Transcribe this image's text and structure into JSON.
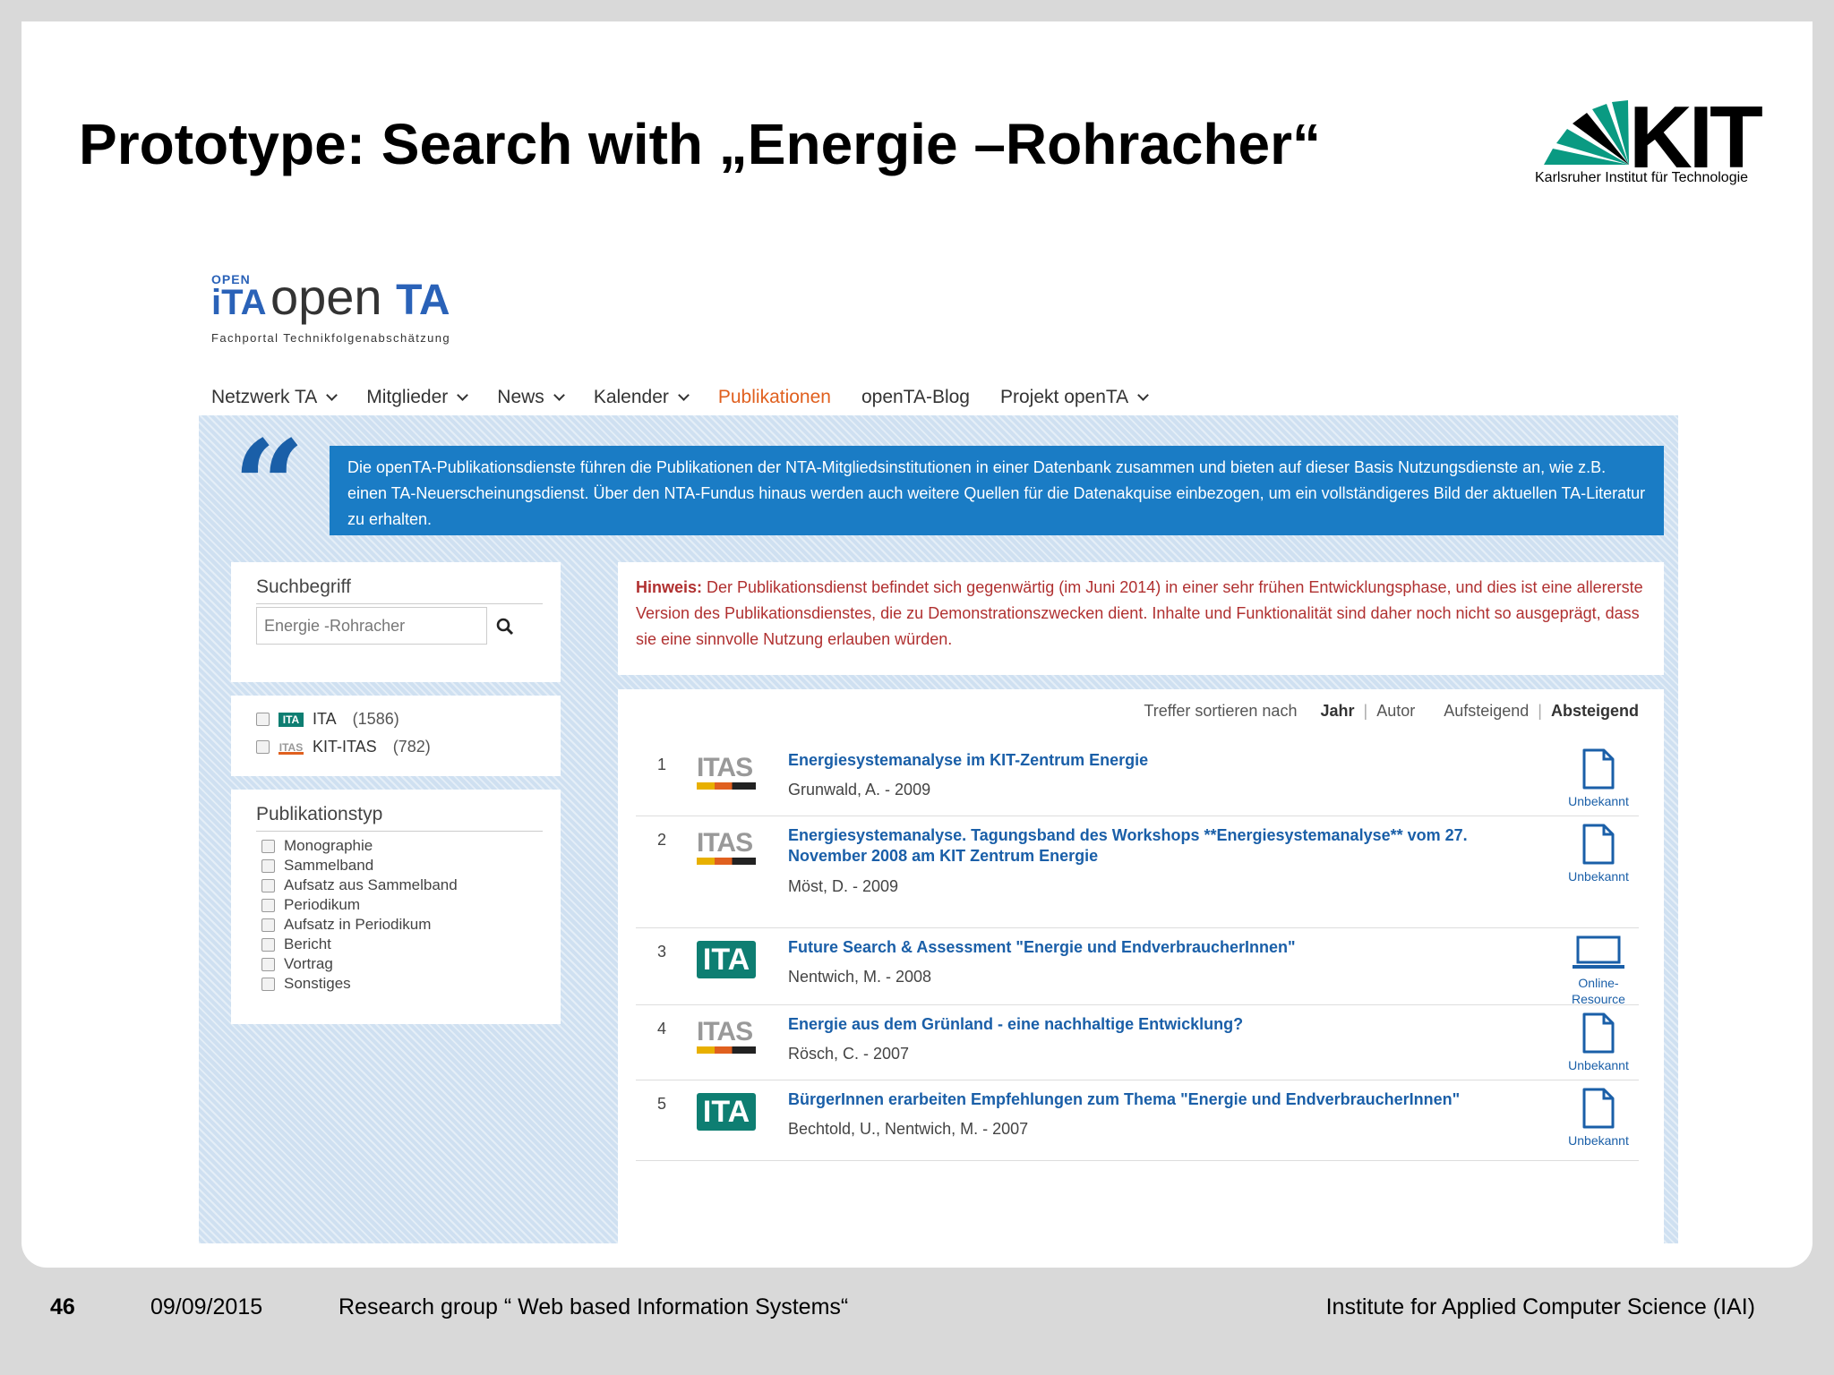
{
  "slide": {
    "title": "Prototype: Search with „Energie  –Rohracher“",
    "logo": {
      "name": "KIT",
      "subtitle": "Karlsruher Institut für Technologie"
    }
  },
  "site": {
    "logo": {
      "badge_top": "OPEN",
      "badge_main": "iTA",
      "word_open": "open",
      "word_ta": "TA",
      "subtitle": "Fachportal Technikfolgenabschätzung"
    },
    "nav": [
      {
        "label": "Netzwerk TA",
        "dropdown": true,
        "active": false
      },
      {
        "label": "Mitglieder",
        "dropdown": true,
        "active": false
      },
      {
        "label": "News",
        "dropdown": true,
        "active": false
      },
      {
        "label": "Kalender",
        "dropdown": true,
        "active": false
      },
      {
        "label": "Publikationen",
        "dropdown": false,
        "active": true
      },
      {
        "label": "openTA-Blog",
        "dropdown": false,
        "active": false
      },
      {
        "label": "Projekt openTA",
        "dropdown": true,
        "active": false
      }
    ],
    "quote_mark": "“",
    "intro": "Die openTA-Publikationsdienste führen die Publikationen der NTA-Mitgliedsinstitutionen in einer Datenbank zusammen und bieten auf dieser Basis Nutzungsdienste an, wie z.B. einen TA-Neuerscheinungsdienst. Über den NTA-Fundus hinaus werden auch weitere Quellen für die Datenakquise einbezogen, um ein vollständigeres Bild der aktuellen TA-Literatur zu erhalten."
  },
  "search": {
    "heading": "Suchbegriff",
    "value": "Energie -Rohracher",
    "icon": "search-icon"
  },
  "institutions": [
    {
      "badge": "ITA",
      "label": "ITA",
      "count": "(1586)"
    },
    {
      "badge": "ITAS",
      "label": "KIT-ITAS",
      "count": "(782)"
    }
  ],
  "pubtype": {
    "heading": "Publikationstyp",
    "items": [
      "Monographie",
      "Sammelband",
      "Aufsatz aus Sammelband",
      "Periodikum",
      "Aufsatz in Periodikum",
      "Bericht",
      "Vortrag",
      "Sonstiges"
    ]
  },
  "hint": {
    "label": "Hinweis:",
    "text": " Der Publikationsdienst befindet sich gegenwärtig (im Juni 2014) in einer sehr frühen Entwicklungsphase, und dies ist eine allererste Version des Publikationsdienstes, die zu Demonstrationszwecken dient. Inhalte und Funktionalität sind daher noch nicht so ausgeprägt, dass sie eine sinnvolle Nutzung erlauben würden."
  },
  "sort": {
    "label": "Treffer sortieren nach",
    "year": "Jahr",
    "sep": "|",
    "author": "Autor",
    "asc": "Aufsteigend",
    "desc": "Absteigend"
  },
  "results": [
    {
      "num": "1",
      "logo": "ITAS",
      "title": "Energiesystemanalyse im KIT-Zentrum Energie",
      "meta": "Grunwald, A. -  2009",
      "type": "Unbekannt",
      "type_icon": "document-icon"
    },
    {
      "num": "2",
      "logo": "ITAS",
      "title": "Energiesystemanalyse. Tagungsband des Workshops **Energiesystemanalyse** vom 27. November 2008 am KIT Zentrum Energie",
      "meta": "Möst, D. -  2009",
      "type": "Unbekannt",
      "type_icon": "document-icon"
    },
    {
      "num": "3",
      "logo": "ITA",
      "title": "Future Search & Assessment \"Energie und EndverbraucherInnen\"",
      "meta": "Nentwich, M. -  2008",
      "type": "Online-Resource",
      "type_icon": "laptop-icon"
    },
    {
      "num": "4",
      "logo": "ITAS",
      "title": "Energie aus dem Grünland - eine nachhaltige Entwicklung?",
      "meta": "Rösch, C. -  2007",
      "type": "Unbekannt",
      "type_icon": "document-icon"
    },
    {
      "num": "5",
      "logo": "ITA",
      "title": "BürgerInnen erarbeiten Empfehlungen zum Thema \"Energie und EndverbraucherInnen\"",
      "meta": "Bechtold, U., Nentwich, M. -  2007",
      "type": "Unbekannt",
      "type_icon": "document-icon"
    }
  ],
  "footer": {
    "page": "46",
    "date": "09/09/2015",
    "group": "Research group “ Web based  Information Systems“",
    "institute": "Institute for Applied Computer Science (IAI)"
  }
}
